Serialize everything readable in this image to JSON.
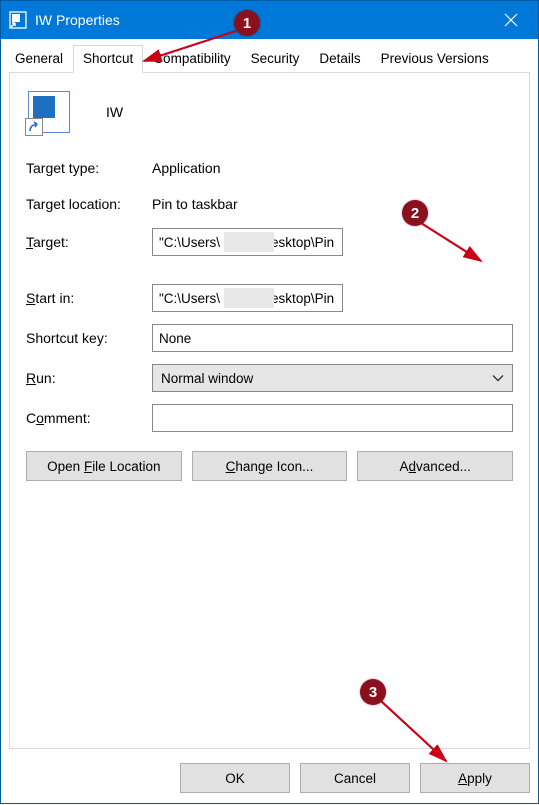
{
  "window": {
    "title": "IW Properties"
  },
  "tabs": {
    "general": "General",
    "shortcut": "Shortcut",
    "compatibility": "Compatibility",
    "security": "Security",
    "details": "Details",
    "previous": "Previous Versions",
    "active": "shortcut"
  },
  "header": {
    "name": "IW"
  },
  "fields": {
    "target_type_label": "Target type:",
    "target_type_value": "Application",
    "target_location_label": "Target location:",
    "target_location_value": "Pin to taskbar",
    "target_label_pre": "",
    "target_label_u": "T",
    "target_label_post": "arget:",
    "target_value": "\"C:\\Users\\          \\Desktop\\Pin to taskbar\\IW.docx\"",
    "startin_label_pre": "",
    "startin_label_u": "S",
    "startin_label_post": "tart in:",
    "startin_value": "\"C:\\Users\\          \\Desktop\\Pin to taskbar\"",
    "shortcutkey_label": "Shortcut key:",
    "shortcutkey_value": "None",
    "run_label_pre": "",
    "run_label_u": "R",
    "run_label_post": "un:",
    "run_value": "Normal window",
    "comment_label_pre": "C",
    "comment_label_u": "o",
    "comment_label_post": "mment:",
    "comment_value": ""
  },
  "buttons": {
    "open_loc_pre": "Open ",
    "open_loc_u": "F",
    "open_loc_post": "ile Location",
    "change_icon_pre": "",
    "change_icon_u": "C",
    "change_icon_post": "hange Icon...",
    "advanced_pre": "A",
    "advanced_u": "d",
    "advanced_post": "vanced...",
    "ok": "OK",
    "cancel": "Cancel",
    "apply_pre": "",
    "apply_u": "A",
    "apply_post": "pply"
  },
  "annotations": {
    "b1": "1",
    "b2": "2",
    "b3": "3"
  }
}
